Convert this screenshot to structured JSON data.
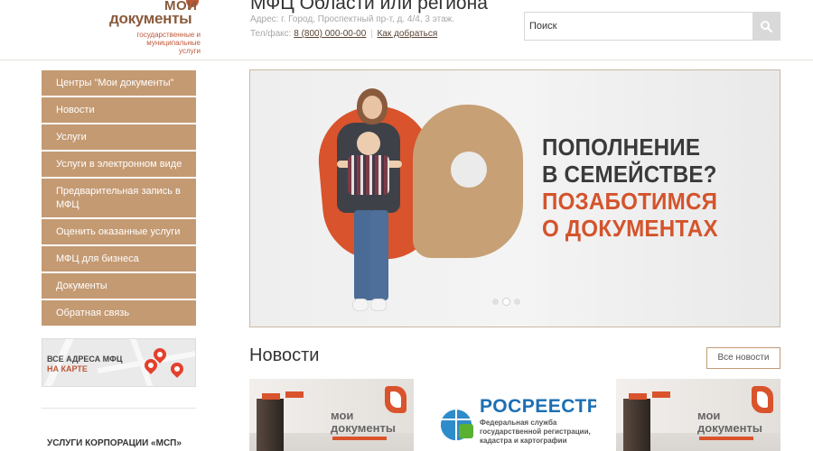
{
  "header": {
    "logo_line1": "МОИ",
    "logo_line2": "документы",
    "logo_sub": "государственные и муниципальные услуги",
    "title": "МФЦ Области или региона",
    "address": "Адрес: г. Город, Проспектный пр-т, д. 4/4, 3 этаж.",
    "phone_label": "Тел/факс",
    "phone": "8 (800) 000-00-00",
    "separator": "|",
    "directions": "Как добраться"
  },
  "search": {
    "placeholder": "Поиск",
    "icon": "search-icon"
  },
  "sidebar": {
    "items": [
      {
        "label": "Центры \"Мои документы\""
      },
      {
        "label": "Новости"
      },
      {
        "label": "Услуги"
      },
      {
        "label": "Услуги в электронном виде"
      },
      {
        "label": "Предварительная запись в МФЦ"
      },
      {
        "label": "Оценить оказанные услуги"
      },
      {
        "label": "МФЦ для бизнеса"
      },
      {
        "label": "Документы"
      },
      {
        "label": "Обратная связь"
      }
    ]
  },
  "map_banner": {
    "line1": "ВСЕ АДРЕСА МФЦ",
    "line2": "НА КАРТЕ"
  },
  "msp_banner": {
    "text": "УСЛУГИ КОРПОРАЦИИ «МСП»"
  },
  "slider": {
    "line1": "ПОПОЛНЕНИЕ",
    "line2": "В СЕМЕЙСТВЕ?",
    "line3": "ПОЗАБОТИМСЯ",
    "line4": "О ДОКУМЕНТАХ",
    "dots_count": 3,
    "active_dot": 2
  },
  "news": {
    "title": "Новости",
    "all_button": "Все новости",
    "cards": [
      {
        "type": "office",
        "logo_text": "мои документы"
      },
      {
        "type": "rosreestr",
        "title": "РОСРЕЕСТР",
        "subtitle_1": "Федеральная служба",
        "subtitle_2": "государственной регистрации,",
        "subtitle_3": "кадастра и картографии"
      },
      {
        "type": "office",
        "logo_text": "мои документы"
      }
    ]
  },
  "colors": {
    "sidebar_bg": "#c49a73",
    "accent_orange": "#d4542c",
    "brand_brown": "#8a5a3c"
  }
}
